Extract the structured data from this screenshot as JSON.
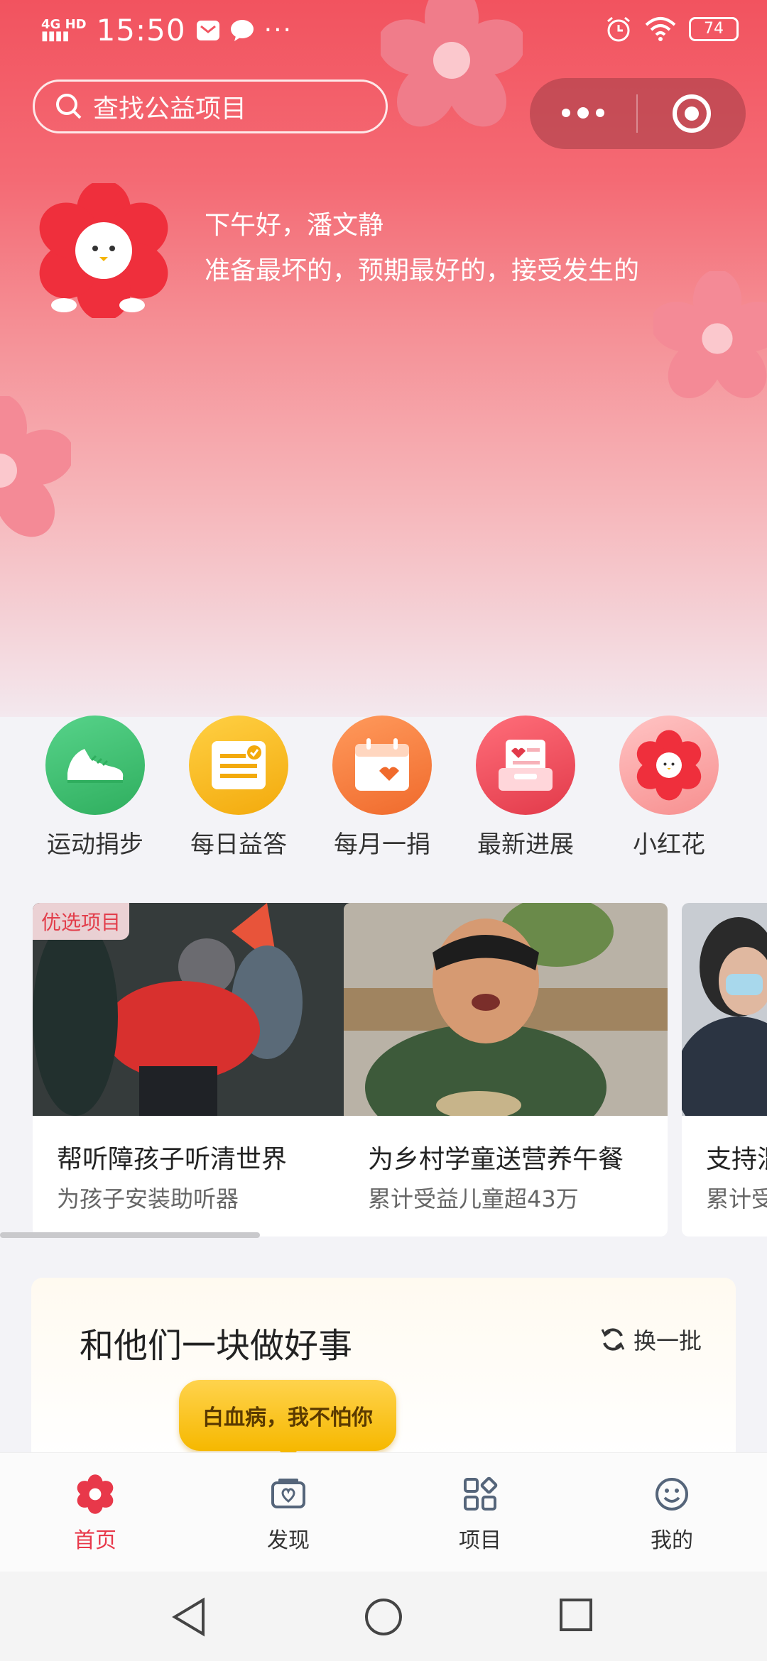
{
  "status_bar": {
    "network": "4G HD",
    "time": "15:50",
    "battery": "74"
  },
  "search": {
    "placeholder": "查找公益项目"
  },
  "greeting": {
    "line1": "下午好，潘文静",
    "line2": "准备最坏的，预期最好的，接受发生的"
  },
  "quick_entries": [
    {
      "label": "运动捐步",
      "icon": "sneaker-icon",
      "color": "#3fc16f"
    },
    {
      "label": "每日益答",
      "icon": "quiz-card-icon",
      "color": "#f7bd1a"
    },
    {
      "label": "每月一捐",
      "icon": "calendar-heart-icon",
      "color": "#f47c3c"
    },
    {
      "label": "最新进展",
      "icon": "inbox-heart-icon",
      "color": "#ef4f5c"
    },
    {
      "label": "小红花",
      "icon": "red-flower-icon",
      "color": "#f7a5a5"
    }
  ],
  "cards": [
    {
      "tag": "优选项目",
      "title": "帮听障孩子听清世界",
      "subtitle": "为孩子安装助听器"
    },
    {
      "tag": "",
      "title": "为乡村学童送营养午餐",
      "subtitle": "累计受益儿童超43万"
    },
    {
      "tag": "",
      "title": "支持混",
      "subtitle": "累计受"
    }
  ],
  "do_good": {
    "title": "和他们一块做好事",
    "refresh_label": "换一批"
  },
  "tooltip": {
    "text": "白血病，我不怕你"
  },
  "tabbar": [
    {
      "label": "首页",
      "icon": "flower-home-icon",
      "active": true
    },
    {
      "label": "发现",
      "icon": "discover-icon",
      "active": false
    },
    {
      "label": "项目",
      "icon": "apps-grid-icon",
      "active": false
    },
    {
      "label": "我的",
      "icon": "smiley-icon",
      "active": false
    }
  ],
  "colors": {
    "brand_red": "#e8384a",
    "hero_top": "#f2535f",
    "tooltip_yellow": "#f6b800"
  }
}
